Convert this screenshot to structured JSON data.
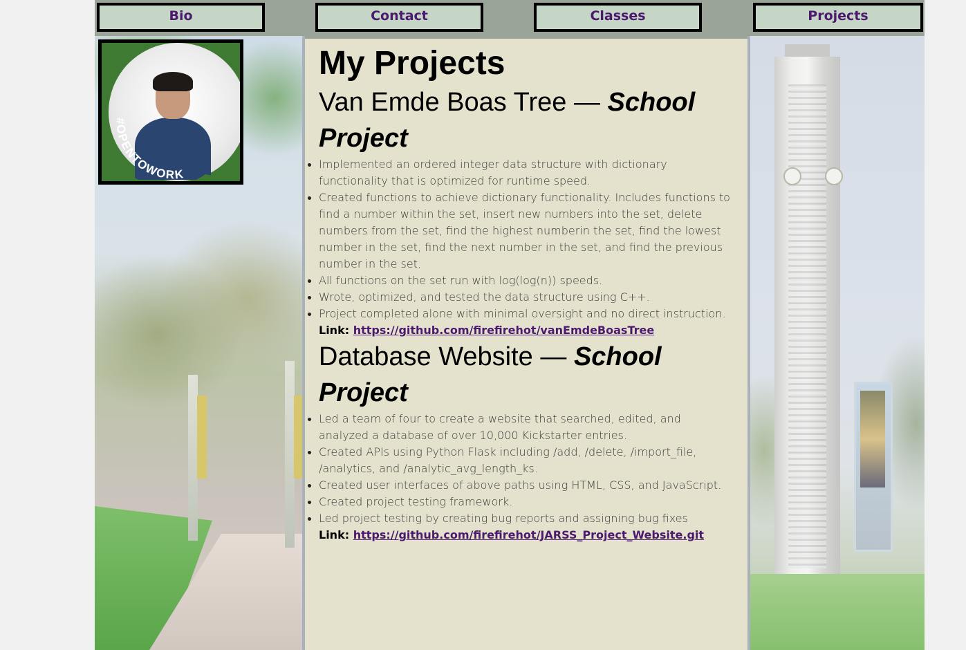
{
  "nav": {
    "items": [
      {
        "label": "Bio"
      },
      {
        "label": "Contact"
      },
      {
        "label": "Classes"
      },
      {
        "label": "Projects"
      }
    ]
  },
  "profile": {
    "badge_text": "#OPENTOWORK"
  },
  "main": {
    "title": "My Projects",
    "projects": [
      {
        "name": "Van Emde Boas Tree — ",
        "type": "School Project",
        "points": [
          "Implemented an ordered integer data structure with dictionary functionality that is optimized for runtime speed.",
          "Created functions to achieve dictionary functionality. Includes functions to find a number within the set, insert new numbers into the set, delete numbers from the set, find the highest numberin the set, find the lowest number in the set, find the next number in the set, and find the previous number in the set.",
          "All functions on the set run with log(log(n)) speeds.",
          "Wrote, optimized, and tested the data structure using C++.",
          "Project completed alone with minimal oversight and no direct instruction."
        ],
        "link_label": "Link: ",
        "link_url": "https://github.com/firefirehot/vanEmdeBoasTree"
      },
      {
        "name": "Database Website — ",
        "type": "School Project",
        "points": [
          "Led a team of four to create a website that searched, edited, and analyzed a database of over 10,000 Kickstarter entries.",
          "Created APIs using Python Flask including /add, /delete, /import_file, /analytics, and /analytic_avg_length_ks.",
          "Created user interfaces of above paths using HTML, CSS, and JavaScript.",
          "Created project testing framework.",
          "Led project testing by creating bug reports and assigning bug fixes"
        ],
        "link_label": "Link: ",
        "link_url": "https://github.com/firefirehot/JARSS_Project_Website.git"
      }
    ]
  },
  "colors": {
    "nav_bg": "#c5d5c6",
    "nav_text": "#4b1a6e",
    "content_bg": "#e4e1cd",
    "link": "#4b1a6e",
    "opentowork_green": "#3f7a32"
  }
}
